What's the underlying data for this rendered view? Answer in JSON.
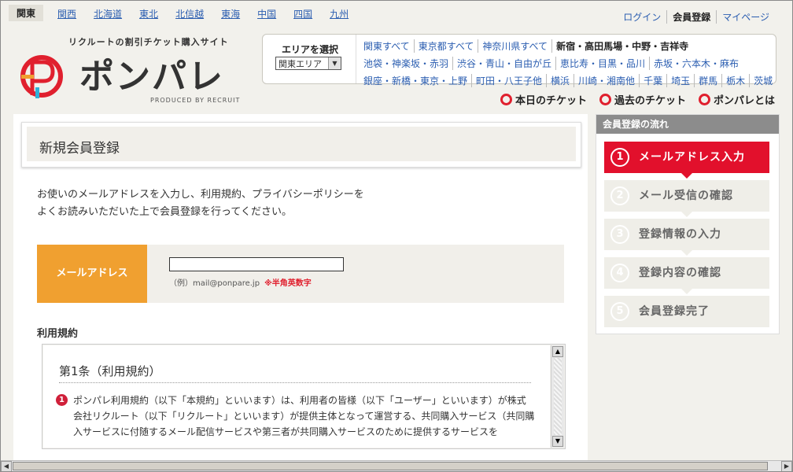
{
  "regions": [
    "関東",
    "関西",
    "北海道",
    "東北",
    "北信越",
    "東海",
    "中国",
    "四国",
    "九州"
  ],
  "toplinks": {
    "login": "ログイン",
    "register": "会員登録",
    "mypage": "マイページ"
  },
  "logo": {
    "tagline": "リクルートの割引チケット購入サイト",
    "name": "ポンパレ",
    "sub": "PRODUCED BY RECRUIT"
  },
  "area": {
    "title": "エリアを選択",
    "selected": "関東エリア",
    "row1": [
      "関東すべて",
      "東京都すべて",
      "神奈川県すべて",
      "新宿・高田馬場・中野・吉祥寺"
    ],
    "row2": [
      "池袋・神楽坂・赤羽",
      "渋谷・青山・自由が丘",
      "恵比寿・目黒・品川",
      "赤坂・六本木・麻布"
    ],
    "row3": [
      "銀座・新橋・東京・上野",
      "町田・八王子他",
      "横浜",
      "川崎・湘南他",
      "千葉",
      "埼玉",
      "群馬",
      "栃木",
      "茨城"
    ]
  },
  "nav": {
    "today": "本日のチケット",
    "past": "過去のチケット",
    "about": "ポンパレとは"
  },
  "page": {
    "title": "新規会員登録",
    "intro1": "お使いのメールアドレスを入力し、利用規約、プライバシーポリシーを",
    "intro2": "よくお読みいただいた上で会員登録を行ってください。",
    "email_label": "メールアドレス",
    "email_value": "",
    "email_hint": "（例）mail@ponpare.jp",
    "email_note": "※半角英数字",
    "terms_label": "利用規約",
    "article_title": "第1条（利用規約）",
    "article_num": "1",
    "article_line1": "ポンパレ利用規約（以下「本規約」といいます）は、利用者の皆様（以下「ユーザー」といいます）が株式",
    "article_line2": "会社リクルート（以下「リクルート」といいます）が提供主体となって運営する、共同購入サービス（共同購",
    "article_line3": "入サービスに付随するメール配信サービスや第三者が共同購入サービスのために提供するサービスを"
  },
  "sidebar": {
    "title": "会員登録の流れ",
    "steps": [
      {
        "num": "1",
        "label": "メールアドレス入力"
      },
      {
        "num": "2",
        "label": "メール受信の確認"
      },
      {
        "num": "3",
        "label": "登録情報の入力"
      },
      {
        "num": "4",
        "label": "登録内容の確認"
      },
      {
        "num": "5",
        "label": "会員登録完了"
      }
    ]
  },
  "colors": {
    "accent": "#e2102c",
    "label_bg": "#f0a030",
    "link": "#2a5db0"
  }
}
